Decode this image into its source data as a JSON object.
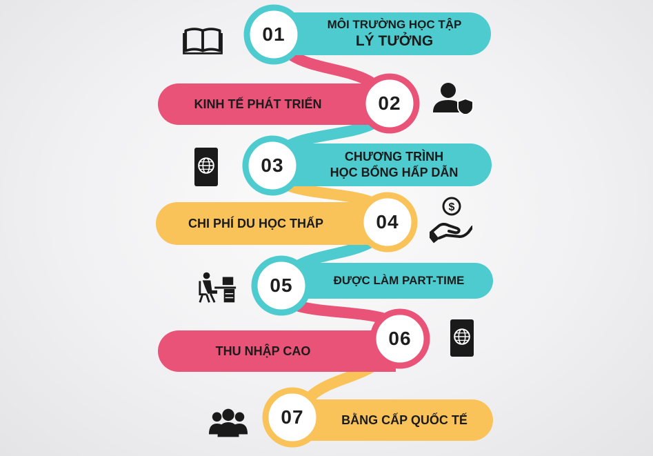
{
  "colors": {
    "teal": "#4ecbcf",
    "pink": "#ea5378",
    "yellow": "#f9c35a",
    "icon": "#1a1a1a"
  },
  "steps": [
    {
      "number": "01",
      "lines": [
        "MÔI TRƯỜNG HỌC TẬP",
        "LÝ TƯỞNG"
      ],
      "color": "teal",
      "side": "right",
      "icon": "open-book-icon"
    },
    {
      "number": "02",
      "lines": [
        "KINH TẾ PHÁT TRIỂN"
      ],
      "color": "pink",
      "side": "left",
      "icon": "user-shield-icon"
    },
    {
      "number": "03",
      "lines": [
        "CHƯƠNG TRÌNH",
        "HỌC BỔNG HẤP DẪN"
      ],
      "color": "teal",
      "side": "right",
      "icon": "passport-icon"
    },
    {
      "number": "04",
      "lines": [
        "CHI PHÍ DU HỌC THẤP"
      ],
      "color": "yellow",
      "side": "left",
      "icon": "hand-coin-icon"
    },
    {
      "number": "05",
      "lines": [
        "ĐƯỢC LÀM PART-TIME"
      ],
      "color": "teal",
      "side": "right",
      "icon": "person-at-desk-icon"
    },
    {
      "number": "06",
      "lines": [
        "THU NHẬP CAO"
      ],
      "color": "pink",
      "side": "left",
      "icon": "passport-icon"
    },
    {
      "number": "07",
      "lines": [
        "BẰNG CẤP QUỐC TẾ"
      ],
      "color": "yellow",
      "side": "right",
      "icon": "group-users-icon"
    }
  ]
}
